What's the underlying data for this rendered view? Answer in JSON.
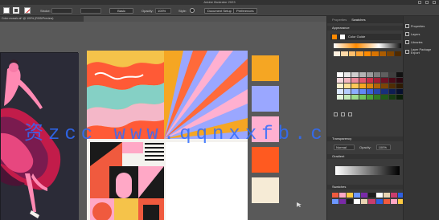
{
  "app": {
    "title": "Adobe Illustrator 2023"
  },
  "controlbar": {
    "stroke_label": "Stroke:",
    "basic_label": "Basic",
    "opacity_label": "Opacity:",
    "opacity_value": "100%",
    "style_label": "Style:",
    "document_setup": "Document Setup",
    "preferences": "Preferences"
  },
  "document": {
    "tab": "Color-mosaic.ai* @ 100% (RGB/Preview)"
  },
  "panel": {
    "tabs": [
      "Properties",
      "Swatches"
    ],
    "appearance": "Appearance",
    "color_guide": "Color Guide",
    "transparency": "Transparency",
    "gradient": "Gradient",
    "swatches": "Swatches",
    "blend_mode": "Normal",
    "opacity_label": "Opacity:",
    "opacity_value": "100%",
    "swatch_colors": [
      "#ffffff",
      "#e8e8e8",
      "#cfcfcf",
      "#b4b4b4",
      "#9a9a9a",
      "#7d7d7d",
      "#5f5f5f",
      "#3f3f3f",
      "#111111",
      "#f7d9dd",
      "#f3b7c0",
      "#ec8a9a",
      "#e0586d",
      "#c73048",
      "#a11d33",
      "#6f1124",
      "#4a0b18",
      "#2b0710",
      "#fff2cf",
      "#ffe199",
      "#ffc857",
      "#f5a623",
      "#d98310",
      "#b0630a",
      "#7c4406",
      "#4f2c04",
      "#2e1a03",
      "#dbe8ff",
      "#b5cdff",
      "#8cadff",
      "#6188f5",
      "#3b62da",
      "#2646ad",
      "#182f7c",
      "#0e1d52",
      "#07102f",
      "#e3f5de",
      "#c4eab8",
      "#9ddc8b",
      "#6fc35a",
      "#49a135",
      "#317c22",
      "#225a18",
      "#163b10",
      "#0b1f08"
    ],
    "bottom_swatches": [
      "#f05a3e",
      "#ffa8c6",
      "#fcca42",
      "#6c97ff",
      "#7a2aa8",
      "#1d1d1d",
      "#ffffff",
      "#e9d4b3",
      "#c93d6d",
      "#2e5fe0"
    ]
  },
  "right_panel": {
    "items": [
      "Properties",
      "Layers",
      "Libraries",
      "Layer Package Export"
    ]
  },
  "watermark": {
    "text": "资zcc www.qqnxxfb.cn"
  }
}
